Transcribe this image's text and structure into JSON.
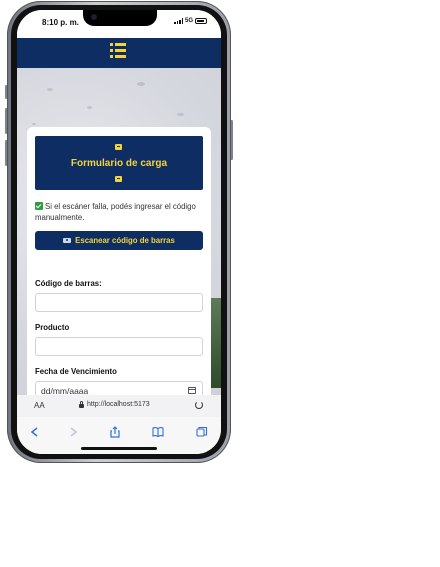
{
  "status_bar": {
    "time": "8:10 p. m.",
    "network": "5G"
  },
  "app_header": {
    "menu_icon": "list-menu-icon"
  },
  "form": {
    "title": "Formulario de carga",
    "hint": "Si el escáner falla, podés ingresar el código manualmente.",
    "scan_button_label": "Escanear código de barras",
    "fields": [
      {
        "label": "Código de barras:",
        "value": ""
      },
      {
        "label": "Producto",
        "value": ""
      },
      {
        "label": "Fecha de Vencimiento",
        "value": "dd/mm/aaaa"
      }
    ]
  },
  "browser": {
    "aa_label": "AA",
    "url": "http://localhost:5173",
    "toolbar_icons": [
      "back-icon",
      "forward-icon",
      "share-icon",
      "bookmarks-icon",
      "tabs-icon"
    ]
  },
  "colors": {
    "navy": "#0d2d63",
    "accent": "#f4d43c",
    "check_green": "#2e9e44"
  }
}
